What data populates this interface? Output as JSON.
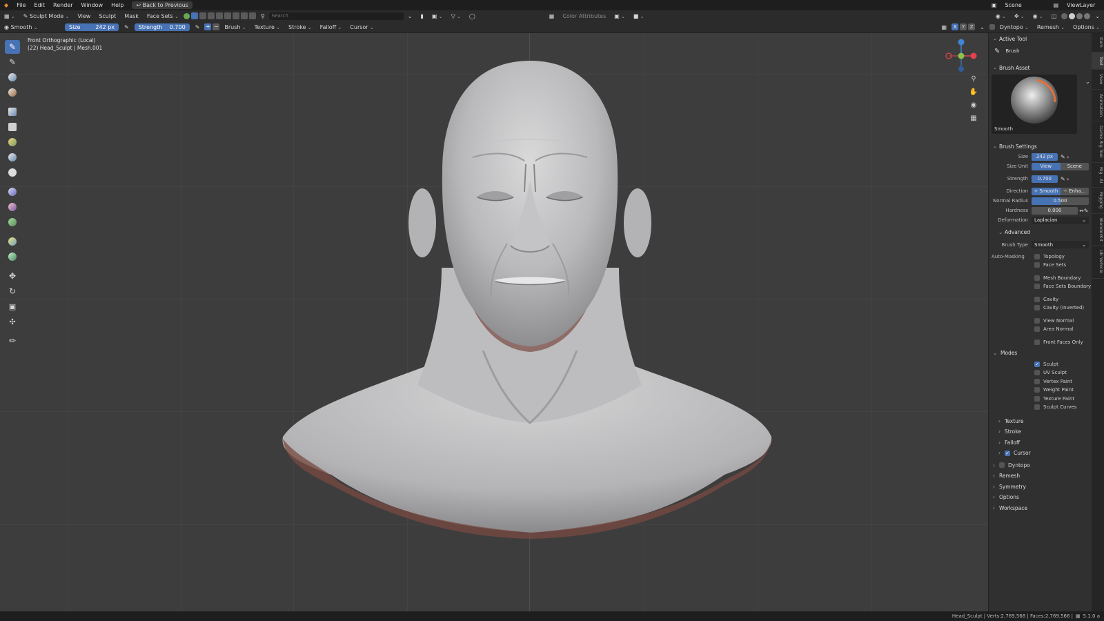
{
  "topbar": {
    "menus": [
      "File",
      "Edit",
      "Render",
      "Window",
      "Help"
    ],
    "back_button": "Back to Previous",
    "scene": "Scene",
    "view_layer": "ViewLayer"
  },
  "header1": {
    "mode": "Sculpt Mode",
    "menus": [
      "View",
      "Sculpt",
      "Mask",
      "Face Sets"
    ],
    "search_placeholder": "Search",
    "color_attributes": "Color Attributes"
  },
  "header2": {
    "brush_name": "Smooth",
    "size_label": "Size",
    "size_value": "242 px",
    "strength_label": "Strength",
    "strength_value": "0.700",
    "menus": [
      "Brush",
      "Texture",
      "Stroke",
      "Falloff",
      "Cursor"
    ],
    "axes": [
      "X",
      "Y",
      "Z"
    ],
    "right_menus": [
      "Dyntopo",
      "Remesh",
      "Options"
    ]
  },
  "viewport": {
    "view_name": "Front Orthographic (Local)",
    "object_info": "(22) Head_Sculpt | Mesh.001"
  },
  "sidebar": {
    "active_tool_header": "Active Tool",
    "active_tool_name": "Brush",
    "brush_asset_header": "Brush Asset",
    "brush_asset_name": "Smooth",
    "brush_settings_header": "Brush Settings",
    "size_label": "Size",
    "size_value": "242 px",
    "size_unit_label": "Size Unit",
    "size_unit_view": "View",
    "size_unit_scene": "Scene",
    "strength_label": "Strength",
    "strength_value": "0.700",
    "direction_label": "Direction",
    "direction_smooth": "Smooth",
    "direction_enhance": "Enha...",
    "normal_radius_label": "Normal Radius",
    "normal_radius_value": "0.500",
    "normal_radius_fraction": 0.5,
    "hardness_label": "Hardness",
    "hardness_value": "0.000",
    "deformation_label": "Deformation",
    "deformation_value": "Laplacian",
    "advanced_header": "Advanced",
    "brush_type_label": "Brush Type",
    "brush_type_value": "Smooth",
    "auto_masking_label": "Auto-Masking",
    "auto_masking": [
      {
        "label": "Topology",
        "checked": false
      },
      {
        "label": "Face Sets",
        "checked": false
      },
      {
        "label": "Mesh Boundary",
        "checked": false
      },
      {
        "label": "Face Sets Boundary",
        "checked": false
      },
      {
        "label": "Cavity",
        "checked": false
      },
      {
        "label": "Cavity (Inverted)",
        "checked": false
      },
      {
        "label": "View Normal",
        "checked": false
      },
      {
        "label": "Area Normal",
        "checked": false
      },
      {
        "label": "Front Faces Only",
        "checked": false
      }
    ],
    "modes_header": "Modes",
    "modes": [
      {
        "label": "Sculpt",
        "checked": true
      },
      {
        "label": "UV Sculpt",
        "checked": false
      },
      {
        "label": "Vertex Paint",
        "checked": false
      },
      {
        "label": "Weight Paint",
        "checked": false
      },
      {
        "label": "Texture Paint",
        "checked": false
      },
      {
        "label": "Sculpt Curves",
        "checked": false
      }
    ],
    "sub_panels": [
      "Texture",
      "Stroke",
      "Falloff",
      "Cursor"
    ],
    "panels": [
      "Dyntopo",
      "Remesh",
      "Symmetry",
      "Options",
      "Workspace"
    ]
  },
  "tabs": [
    "Item",
    "Tool",
    "View",
    "Animation",
    "Game Rig Tool",
    "Rig - AI",
    "Rigging",
    "BlenderKit",
    "UE Vehicle"
  ],
  "statusbar": {
    "text": "Head_Sculpt | Verts:2,769,568 | Faces:2,769,566 |",
    "version": "5.1.0 a"
  },
  "colors": {
    "accent": "#4772b3",
    "viewport_bg": "#3d3d3d",
    "panel_bg": "#303030",
    "header_bg": "#2b2b2b",
    "topbar_bg": "#1e1e1e",
    "gizmo_x": "#e0434d",
    "gizmo_y": "#8bc34a",
    "gizmo_z": "#3f86d8"
  }
}
